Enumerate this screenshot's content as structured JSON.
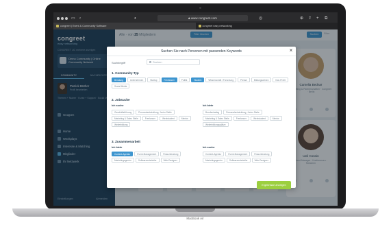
{
  "browser": {
    "address": "www.congreet.com",
    "tabs": [
      {
        "label": "congreet | Event & Community Software"
      },
      {
        "label": "congreet easy networking"
      }
    ]
  },
  "sidebar": {
    "brand": "congreet",
    "brand_sub": "easy networking",
    "small_text": "CONGREET LIC   mehrere anzeigen",
    "community_name": "Demo Community | Online Community Network",
    "tabs": [
      "COMMUNITY",
      "NACHRICHTEN"
    ],
    "profile": {
      "name": "Patrick Büther",
      "role": "Profil bearbeiten"
    },
    "profile_tags": "Themen + Nutzer · Kurse + Support · Social Media",
    "links": [
      "Gruppen",
      "Home",
      "Weekplays",
      "Interesse & Matching",
      "Mitglieder",
      "Ihr Netzwerk"
    ],
    "footer_left": "Einstellungen",
    "footer_right": "Abmelden"
  },
  "main": {
    "head_prefix": "Alle · von",
    "head_count": "25",
    "head_suffix": "Mitgliedern",
    "filter_button": "Filter löschen",
    "search_button": "Suchen",
    "filter_link": "Filter"
  },
  "cards": [
    {
      "name": "Camelia Bednar",
      "desc": "Marketing & Partnerschaften · Congreet · Berlin"
    },
    {
      "name": "Ueli Corwin",
      "desc": "Event Manager · Konferenzen · München"
    }
  ],
  "modal": {
    "title": "Suchen Sie nach Personen mit passenden Keywords",
    "close": "×",
    "keyword_label": "Suchbegriff",
    "keyword_placeholder": "Suchen",
    "sections": [
      {
        "title": "1. Community-Typ"
      },
      {
        "title": "2. Jobsuche",
        "left_label": "Ich suche",
        "right_label": "Ich biete"
      },
      {
        "title": "3. Zusammenarbeit",
        "left_label": "Ich biete",
        "right_label": "Ich suche"
      }
    ],
    "community_type_chips": [
      {
        "label": "Beratung",
        "selected": true
      },
      {
        "label": "Unternehmen",
        "selected": false
      },
      {
        "label": "Startup",
        "selected": false
      },
      {
        "label": "Freelancer",
        "selected": true
      },
      {
        "label": "Politik",
        "selected": false
      },
      {
        "label": "Student",
        "selected": true
      },
      {
        "label": "Wissenschaft / Forschung",
        "selected": false
      },
      {
        "label": "Presse",
        "selected": false
      },
      {
        "label": "Bildungswesen",
        "selected": false
      },
      {
        "label": "Non-Profit",
        "selected": false
      },
      {
        "label": "Social Media",
        "selected": false
      }
    ],
    "job_search_left": [
      "Geschäftsführung",
      "Personalentwicklung, Junior Stelle",
      "Marketing & Sales Stelle",
      "Freelancer",
      "Werkstudent",
      "Mentor",
      "Weiterbildung"
    ],
    "job_search_right": [
      "Berufseinstieg",
      "Personalentwicklung, Junior Stelle",
      "Marketing & Sales Stelle",
      "Freelancer",
      "Werkstudent",
      "Mentor",
      "Weiterbildungsplätze"
    ],
    "collab_left": [
      {
        "label": "Content-Agentur",
        "selected": true
      },
      {
        "label": "Event-Management",
        "selected": false
      },
      {
        "label": "Finanzberatung",
        "selected": false
      },
      {
        "label": "Marketingagentur",
        "selected": false
      },
      {
        "label": "Softwareentwickler",
        "selected": false
      },
      {
        "label": "Web-Designer",
        "selected": false
      }
    ],
    "collab_right": [
      {
        "label": "Content-Agentur",
        "selected": false
      },
      {
        "label": "Event-Management",
        "selected": false
      },
      {
        "label": "Finanzberatung",
        "selected": false
      },
      {
        "label": "Marketingagentur",
        "selected": false
      },
      {
        "label": "Softwareentwickler",
        "selected": false
      },
      {
        "label": "Web-Designer",
        "selected": false
      }
    ],
    "submit_label": "Ergebnisse anzeigen"
  },
  "device": {
    "label": "MacBook Air"
  },
  "colors": {
    "accent": "#3d95cf",
    "sidebar": "#1d3d57",
    "submit": "#9ccf3f"
  }
}
